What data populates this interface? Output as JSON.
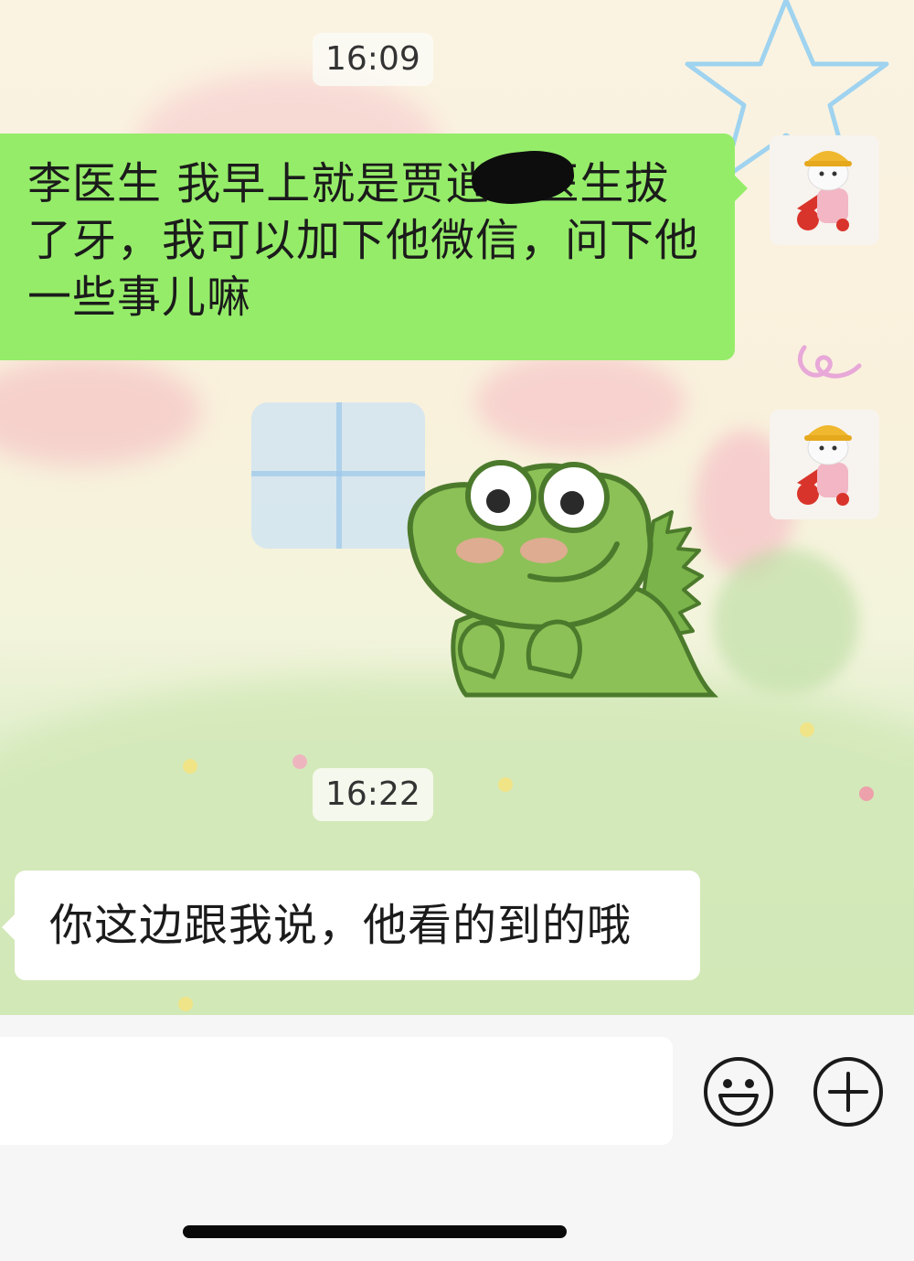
{
  "chat": {
    "messages": [
      {
        "type": "timestamp",
        "text": "16:09"
      },
      {
        "type": "text",
        "sender": "self",
        "text": "李医生 我早上就是贾逍　医生拔了牙，我可以加下他微信，问下他一些事儿嘛",
        "redacted": true
      },
      {
        "type": "sticker",
        "sender": "self",
        "sticker_icon": "blushing-green-dinosaur-sticker"
      },
      {
        "type": "timestamp",
        "text": "16:22"
      },
      {
        "type": "text",
        "sender": "other",
        "text": "你这边跟我说，他看的到的哦"
      }
    ],
    "self_avatar_icon": "cat-with-hat-on-scooter-avatar"
  },
  "input_bar": {
    "placeholder": "",
    "value": "",
    "emoji_icon": "emoji-icon",
    "plus_icon": "plus-icon"
  },
  "colors": {
    "self_bubble": "#95ec69",
    "other_bubble": "#ffffff",
    "input_bar_bg": "#f6f6f6"
  }
}
